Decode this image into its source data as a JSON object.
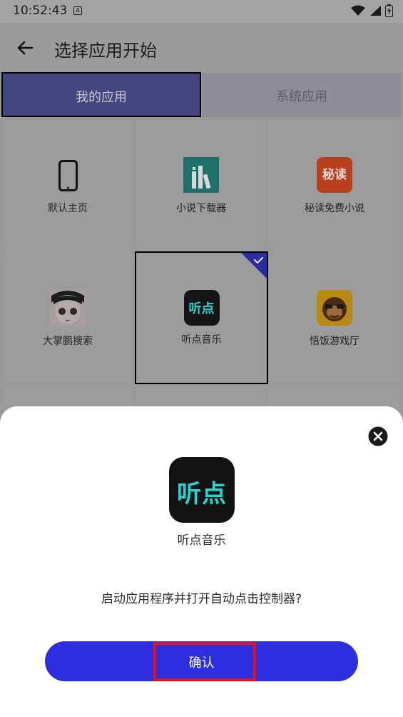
{
  "status_bar": {
    "time": "10:52:43",
    "notification_letter": "A"
  },
  "app_bar": {
    "title": "选择应用开始",
    "back_icon": "arrow-left-icon"
  },
  "tabs": [
    {
      "label": "我的应用",
      "selected": true
    },
    {
      "label": "系统应用",
      "selected": false
    }
  ],
  "apps": [
    {
      "label": "默认主页",
      "icon": "phone-icon"
    },
    {
      "label": "小说下载器",
      "icon": "novel-downloader-icon"
    },
    {
      "label": "秘读免费小说",
      "icon": "miread-icon",
      "icon_text": "秘读"
    },
    {
      "label": "大掌鹏搜索",
      "icon": "anime-avatar-icon"
    },
    {
      "label": "听点音乐",
      "icon": "tingdian-icon",
      "icon_text": "听点",
      "selected": true
    },
    {
      "label": "悟饭游戏厅",
      "icon": "monkey-icon"
    }
  ],
  "dialog": {
    "app_name": "听点音乐",
    "app_icon_text": "听点",
    "question": "启动应用程序并打开自动点击控制器?",
    "confirm_label": "确认",
    "close_icon": "close-icon"
  },
  "colors": {
    "accent": "#2c2ee0",
    "highlight": "#e0141e",
    "tab_selected": "#454580",
    "tingdian_text": "#26d5d0"
  }
}
